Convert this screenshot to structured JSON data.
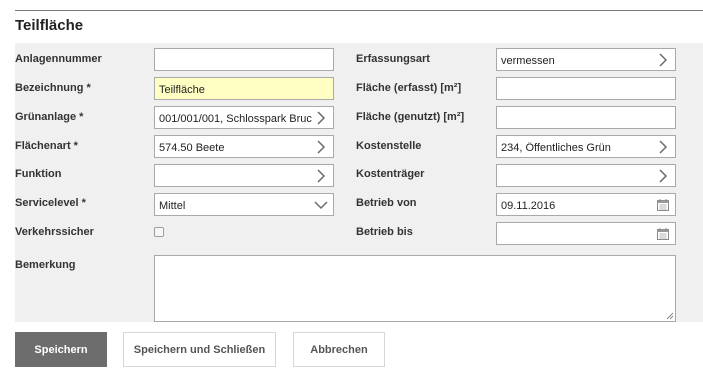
{
  "form": {
    "title": "Teilfläche",
    "left": [
      {
        "label": "Anlagennummer",
        "value": "",
        "required": false,
        "control": "text"
      },
      {
        "label": "Bezeichnung *",
        "value": "Teilfläche",
        "required": true,
        "control": "text"
      },
      {
        "label": "Grünanlage *",
        "value": "001/001/001, Schlosspark Bruc",
        "required": false,
        "control": "lookup"
      },
      {
        "label": "Flächenart *",
        "value": "574.50 Beete",
        "required": false,
        "control": "lookup"
      },
      {
        "label": "Funktion",
        "value": "",
        "required": false,
        "control": "lookup"
      },
      {
        "label": "Servicelevel *",
        "value": "Mittel",
        "required": false,
        "control": "select"
      },
      {
        "label": "Verkehrssicher",
        "checked": false,
        "control": "checkbox"
      }
    ],
    "right": [
      {
        "label": "Erfassungsart",
        "value": "vermessen",
        "control": "lookup"
      },
      {
        "label": "Fläche (erfasst) [m²]",
        "value": "",
        "control": "text"
      },
      {
        "label": "Fläche (genutzt) [m²]",
        "value": "",
        "control": "text"
      },
      {
        "label": "Kostenstelle",
        "value": "234, Öffentliches Grün",
        "control": "lookup"
      },
      {
        "label": "Kostenträger",
        "value": "",
        "control": "lookup"
      },
      {
        "label": "Betrieb von",
        "value": "09.11.2016",
        "control": "date"
      },
      {
        "label": "Betrieb bis",
        "value": "",
        "control": "date"
      }
    ],
    "remark": {
      "label": "Bemerkung",
      "value": ""
    }
  },
  "buttons": {
    "save": "Speichern",
    "save_close": "Speichern und Schließen",
    "cancel": "Abbrechen"
  },
  "icons": {
    "lookup": "chevron-right-icon",
    "select": "chevron-down-icon",
    "date": "calendar-icon"
  },
  "colors": {
    "required_field_bg": "#ffffc4",
    "form_band_bg": "#f0f0f0",
    "primary_button_bg": "#6d6d6d"
  }
}
